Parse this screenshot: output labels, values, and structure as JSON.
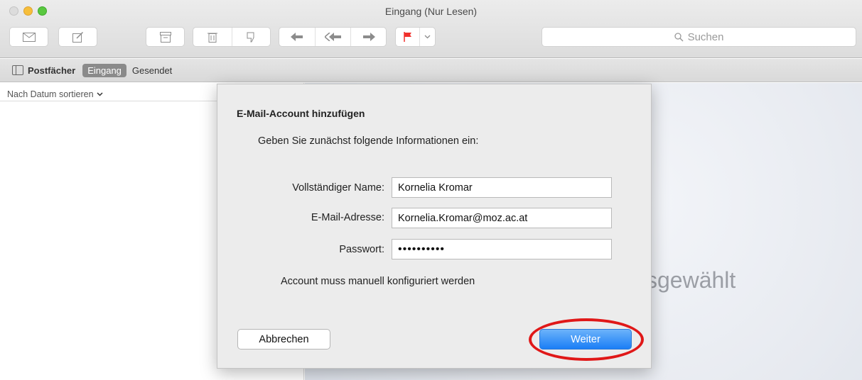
{
  "window": {
    "title": "Eingang (Nur Lesen)"
  },
  "toolbar": {
    "search_placeholder": "Suchen",
    "buttons": [
      "get-mail",
      "compose",
      "archive",
      "delete",
      "junk",
      "reply",
      "reply-all",
      "forward",
      "flag",
      "flag-menu"
    ]
  },
  "favorites": {
    "mailboxes_label": "Postfächer",
    "inbox_label": "Eingang",
    "sent_label": "Gesendet"
  },
  "message_list": {
    "sort_label": "Nach Datum sortieren"
  },
  "viewer": {
    "placeholder_text": "sgewählt"
  },
  "dialog": {
    "title": "E-Mail-Account hinzufügen",
    "subtitle": "Geben Sie zunächst folgende Informationen ein:",
    "fields": {
      "name_label": "Vollständiger Name:",
      "name_value": "Kornelia Kromar",
      "email_label": "E-Mail-Adresse:",
      "email_value": "Kornelia.Kromar@moz.ac.at",
      "password_label": "Passwort:",
      "password_value": "••••••••••"
    },
    "manual_config_text": "Account muss manuell konfiguriert werden",
    "cancel_label": "Abbrechen",
    "next_label": "Weiter"
  },
  "colors": {
    "accent": "#1a7ef6",
    "highlight_ring": "#e01818",
    "flag": "#f0302c"
  }
}
